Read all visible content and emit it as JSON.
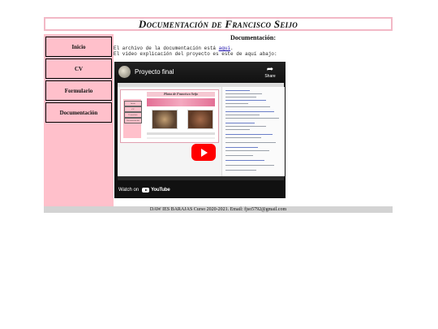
{
  "header": {
    "title": "Documentación de Francisco Seijo"
  },
  "sidebar": {
    "items": [
      {
        "label": "Inicio"
      },
      {
        "label": "CV"
      },
      {
        "label": "Formulario"
      },
      {
        "label": "Documentación"
      }
    ]
  },
  "main": {
    "heading": "Documentación:",
    "line1_prefix": "El archivo de la documentación está ",
    "line1_link": "aquí",
    "line1_suffix": ".",
    "line2": "El video explicación del proyecto es este de aquí abajo:"
  },
  "video": {
    "title": "Proyecto final",
    "share_label": "Share",
    "watch_on": "Watch on",
    "platform": "YouTube",
    "embedded_page_title": "Platos de Francisco Seijo",
    "embedded_nav": [
      "Inicio",
      "CV",
      "Formulario",
      "Documentación"
    ],
    "icons": {
      "share": "share-arrow-icon",
      "play": "play-icon",
      "logo": "youtube-logo-icon"
    },
    "colors": {
      "play_button": "#ff0000",
      "background": "#111111"
    }
  },
  "footer": {
    "text": "DAW IES BARAJAS Curso 2020-2021. Email: fjso5792@gmail.com"
  },
  "colors": {
    "sidebar": "#ffc0cb",
    "header_border": "#f2b8c6",
    "footer": "#d3d3d3"
  }
}
